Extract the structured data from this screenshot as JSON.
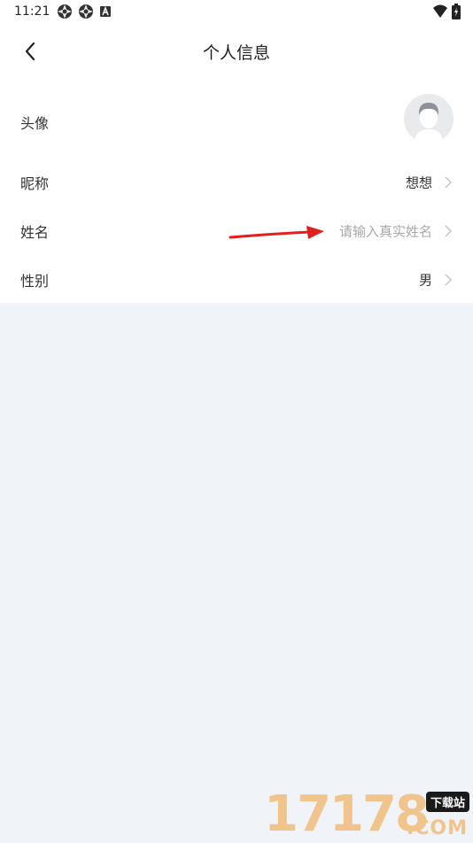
{
  "status_bar": {
    "time": "11:21",
    "icons_left": [
      "aperture-icon",
      "aperture-icon",
      "a-badge-icon"
    ],
    "icons_right": [
      "wifi-icon",
      "battery-charging-icon"
    ]
  },
  "header": {
    "back_icon": "chevron-left-icon",
    "title": "个人信息"
  },
  "rows": [
    {
      "label": "头像",
      "kind": "avatar",
      "icon": "default-avatar-icon"
    },
    {
      "label": "昵称",
      "value": "想想"
    },
    {
      "label": "姓名",
      "placeholder": "请输入真实姓名"
    },
    {
      "label": "性别",
      "value": "男"
    }
  ],
  "annotation": {
    "type": "red-arrow",
    "color": "#e0201e"
  },
  "watermark": {
    "digits": "17178",
    "badge": "下载站",
    "suffix": ".COM"
  },
  "colors": {
    "page_bg": "#f0f3f7",
    "card_bg": "#ffffff",
    "placeholder": "#a8a8a8",
    "chevron": "#c4c4c4",
    "watermark": "#f0c48a"
  }
}
